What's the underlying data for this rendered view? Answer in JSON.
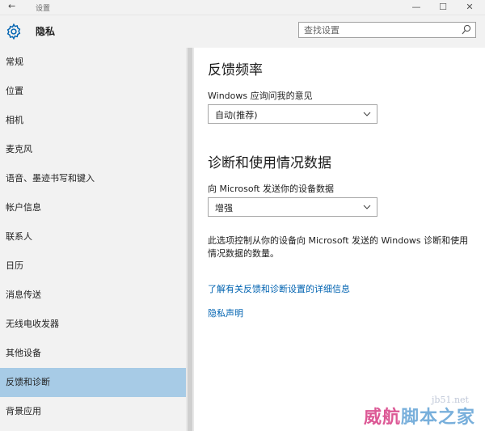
{
  "window": {
    "title": "设置"
  },
  "header": {
    "section_title": "隐私"
  },
  "search": {
    "placeholder": "查找设置"
  },
  "sidebar": {
    "items": [
      {
        "label": "常规"
      },
      {
        "label": "位置"
      },
      {
        "label": "相机"
      },
      {
        "label": "麦克风"
      },
      {
        "label": "语音、墨迹书写和键入"
      },
      {
        "label": "帐户信息"
      },
      {
        "label": "联系人"
      },
      {
        "label": "日历"
      },
      {
        "label": "消息传送"
      },
      {
        "label": "无线电收发器"
      },
      {
        "label": "其他设备"
      },
      {
        "label": "反馈和诊断",
        "selected": true
      },
      {
        "label": "背景应用"
      }
    ]
  },
  "main": {
    "feedback": {
      "heading": "反馈频率",
      "label": "Windows 应询问我的意见",
      "value": "自动(推荐)"
    },
    "diagnostics": {
      "heading": "诊断和使用情况数据",
      "label": "向 Microsoft 发送你的设备数据",
      "value": "增强"
    },
    "description": "此选项控制从你的设备向 Microsoft 发送的 Windows 诊断和使用情况数据的数量。",
    "links": {
      "learn_more": "了解有关反馈和诊断设置的详细信息",
      "privacy": "隐私声明"
    }
  },
  "watermark": {
    "domain": "jb51.net",
    "text_pink": "威航",
    "text_blue": "脚本之家"
  },
  "colors": {
    "accent": "#0063b1",
    "selected": "#a7cbe6",
    "pane": "#f2f2f2"
  }
}
